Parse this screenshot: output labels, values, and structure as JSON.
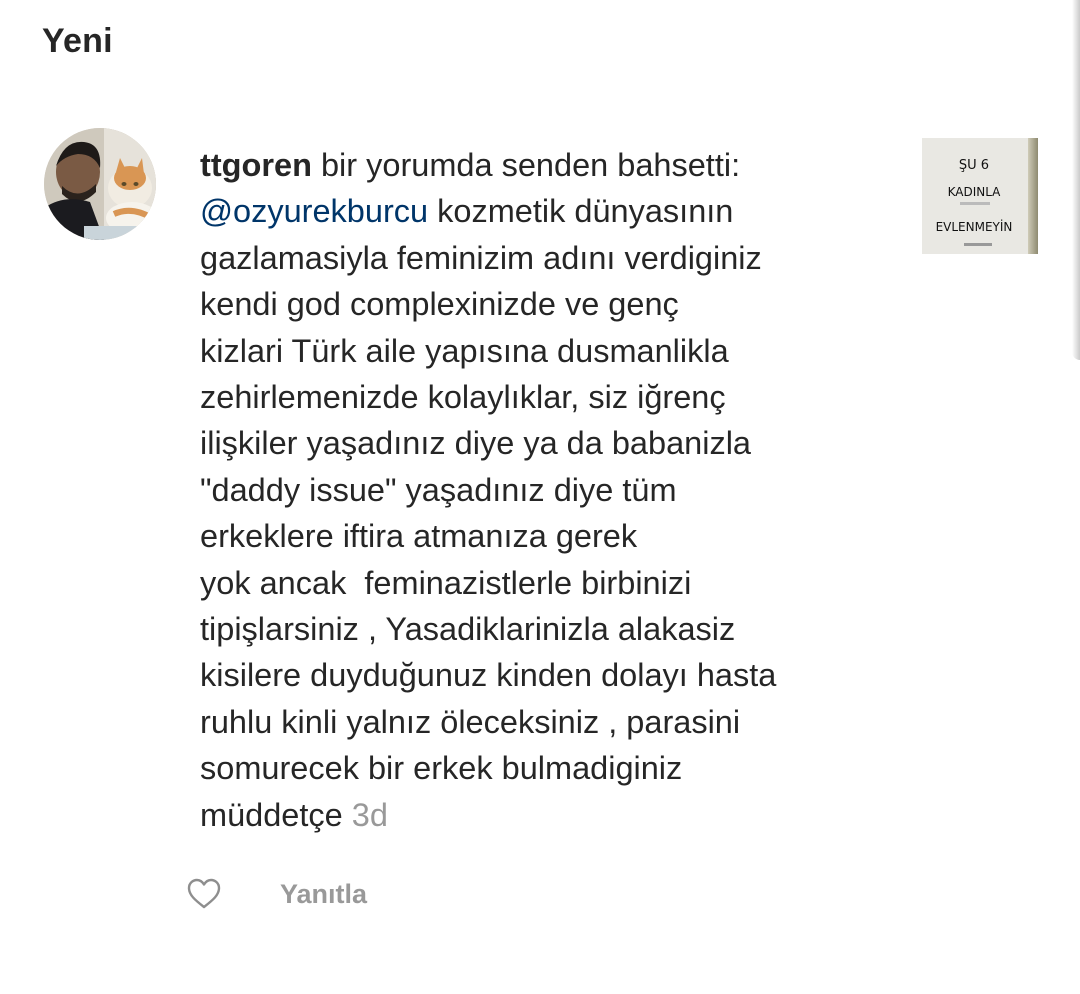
{
  "section": {
    "title": "Yeni"
  },
  "notification": {
    "username": "ttgoren",
    "action": " bir yorumda senden bahsetti:",
    "mention": "@ozyurekburcu",
    "lines": [
      " kozmetik dünyasının",
      "gazlamasiyla feminizim adını verdiginiz",
      "kendi god complexinizde ve genç",
      "kizlari Türk aile yapısına dusmanlikla",
      "zehirlemenizde kolaylıklar, siz iğrenç",
      "ilişkiler yaşadınız diye ya da babanizla",
      "\"daddy issue\" yaşadınız diye tüm",
      "erkeklere iftira atmanıza gerek",
      "yok ancak  feminazistlerle birbinizi",
      "tipişlarsiniz , Yasadiklarinizla alakasiz",
      "kisilere duyduğunuz kinden dolayı hasta",
      "ruhlu kinli yalnız öleceksiniz , parasini",
      "somurecek bir erkek bulmadiginiz",
      "müddetçe"
    ],
    "time": "3d",
    "reply_label": "Yanıtla"
  },
  "thumbnail": {
    "line1": "ŞU 6",
    "line2": "KADINLA",
    "line3": "EVLENMEYİN"
  },
  "icons": {
    "like": "heart-outline-icon"
  },
  "colors": {
    "text": "#262626",
    "mention": "#003569",
    "muted": "#999999"
  }
}
